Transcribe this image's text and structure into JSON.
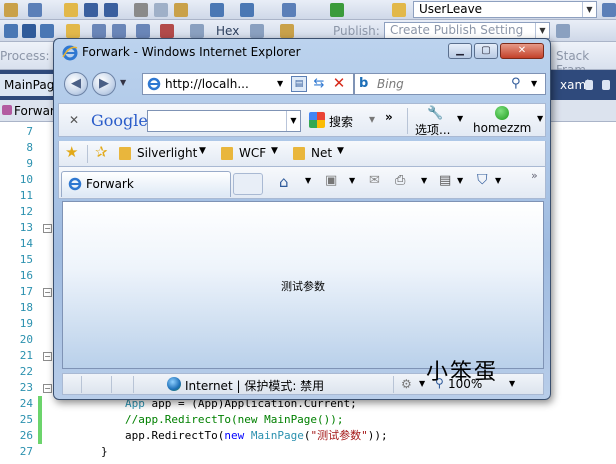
{
  "vs": {
    "toolbar_dropdown": "UserLeave",
    "debug_format": "Hex",
    "publish_label": "Publish:",
    "publish_setting": "Create Publish Setting",
    "process_label": "Process:",
    "stack_frame": "Stack Fram",
    "tabs": [
      "MainPage.",
      "Forwark"
    ],
    "file_tab_right": "xaml",
    "line_numbers": [
      "7",
      "8",
      "9",
      "10",
      "11",
      "12",
      "13",
      "14",
      "15",
      "16",
      "17",
      "18",
      "19",
      "20",
      "21",
      "22",
      "23",
      "24",
      "25",
      "26",
      "27"
    ],
    "code_lines": [
      {
        "n": "24",
        "kw": "",
        "ty": "App",
        "rest": " app = (App)Application.Current;"
      },
      {
        "n": "25",
        "cm": "//app.RedirectTo(new MainPage());"
      },
      {
        "n": "26",
        "a": "app.RedirectTo(",
        "kw": "new",
        "ty": " MainPage",
        "b": "(",
        "st": "\"测试参数\"",
        "c": "));"
      },
      {
        "n": "27",
        "a": "}"
      }
    ]
  },
  "ie": {
    "title": "Forwark - Windows Internet Explorer",
    "address": "http://localh...",
    "search_placeholder": "Bing",
    "google_brand": "Google",
    "google_search_label": "搜索",
    "options_label": "选项...",
    "user_label": "homezzm",
    "favorites": [
      "Silverlight",
      "WCF",
      "Net"
    ],
    "tab_title": "Forwark",
    "page_message": "测试参数",
    "zone_text": "Internet | 保护模式: 禁用",
    "zoom": "100%"
  },
  "watermark": "小笨蛋",
  "colors": {
    "line_number": "#2b91af",
    "keyword": "#0000ff",
    "comment": "#008000",
    "string": "#a31515",
    "change_bar": "#6cd46c",
    "ie_frame": "#9fbbe0"
  }
}
